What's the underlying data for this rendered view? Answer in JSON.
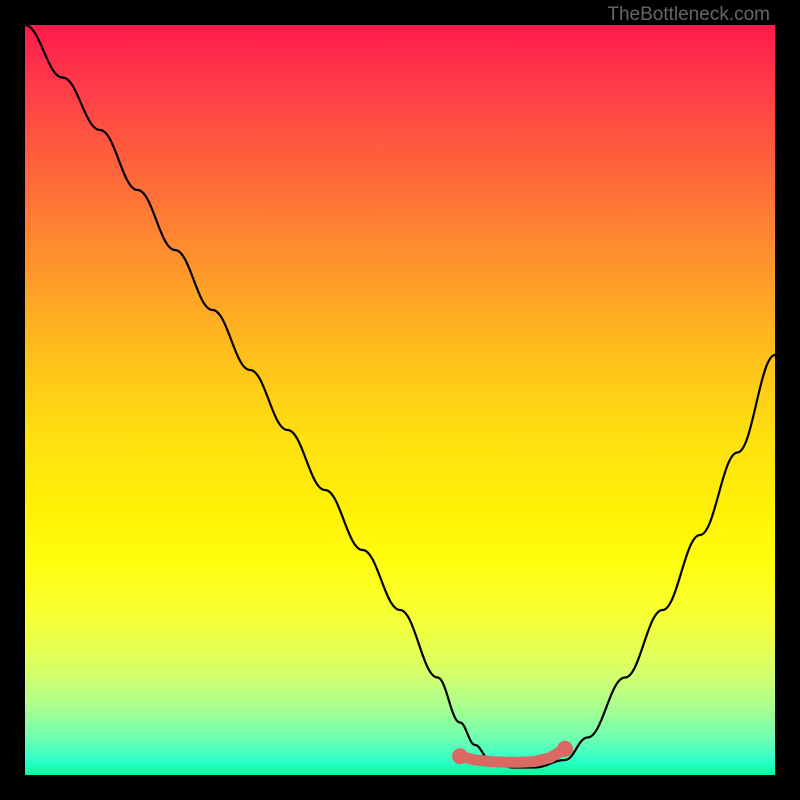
{
  "watermark": "TheBottleneck.com",
  "chart_data": {
    "type": "line",
    "title": "",
    "xlabel": "",
    "ylabel": "",
    "xlim": [
      0,
      100
    ],
    "ylim": [
      0,
      100
    ],
    "series": [
      {
        "name": "bottleneck-curve",
        "x": [
          0,
          5,
          10,
          15,
          20,
          25,
          30,
          35,
          40,
          45,
          50,
          55,
          58,
          60,
          62,
          65,
          68,
          72,
          75,
          80,
          85,
          90,
          95,
          100
        ],
        "y": [
          100,
          93,
          86,
          78,
          70,
          62,
          54,
          46,
          38,
          30,
          22,
          13,
          7,
          4,
          2,
          1,
          1,
          2,
          5,
          13,
          22,
          32,
          43,
          56
        ]
      }
    ],
    "markers": {
      "name": "highlight-range",
      "color": "#d86a63",
      "points_x": [
        58,
        60,
        62,
        64,
        66,
        68,
        70,
        72
      ],
      "points_y": [
        2.5,
        2,
        1.8,
        1.7,
        1.7,
        1.8,
        2.3,
        3.5
      ]
    },
    "background": "rainbow-gradient-vertical"
  }
}
